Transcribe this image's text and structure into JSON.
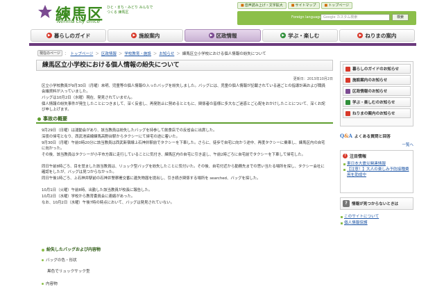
{
  "header": {
    "logo_kanji": "練馬区",
    "logo_roman": "Nerima city office",
    "tagline": "ひと・まち・みどり みんなでつくる 練馬区",
    "top_links": [
      "音声読み上げ・文字拡大",
      "サイトマップ",
      "トップページ"
    ],
    "lang_link": "Foreign language",
    "search_placeholder": "Google カスタム検索",
    "search_button": "検索"
  },
  "nav": [
    {
      "label": "暮らしのガイド",
      "icon": "arrow-circle-icon",
      "color": "#d8382a",
      "active": false
    },
    {
      "label": "施設案内",
      "icon": "arrow-circle-icon",
      "color": "#d8382a",
      "active": false
    },
    {
      "label": "区政情報",
      "icon": "arrow-circle-icon",
      "color": "#7b4a91",
      "active": true
    },
    {
      "label": "学ぶ・楽しむ",
      "icon": "arrow-circle-icon",
      "color": "#2f8f3a",
      "active": false
    },
    {
      "label": "ねりまの案内",
      "icon": "arrow-circle-icon",
      "color": "#d8382a",
      "active": false
    }
  ],
  "breadcrumb": {
    "label": "現在のページ",
    "items": [
      "トップページ",
      "区政情報",
      "学校教育・施設",
      "お知らせ"
    ],
    "current": "練馬区立小学校における個人情報の紛失について"
  },
  "main": {
    "title": "練馬区立小学校における個人情報の紛失について",
    "updated": "更新日：2013年10月2日",
    "intro": [
      "区立小学校教員が9月30日（月曜）未明、児童等の個人情報の入ったバッグを紛失しました。バッグには、児童の個人情報が記載されている過ごとの指導計画および職員会議資料が入っていました。",
      "バッグは10月2日（水曜）現在、発見されていません。",
      "個人情報の紛失事件が発生したことにつきまして、深く反省し、再発防止に努めるとともに、関係者の皆様に多大なご迷惑とご心配をおかけしたことについて、深くお詫び申し上げます。"
    ],
    "section_title": "事故の概要",
    "overview": [
      "9月29日（日曜）は運動会があり、該当教員は紛失したバッグを持参して飲食店での反省会に出席した。",
      "深夜の帰宅となり、西武池袋線練馬高野台駅からタクシーにて帰宅の途に着いた。",
      "9月30日（月曜）午前0時20分に該当教員は西武新宿線上石神井駅前でタクシーを下車した。さらに、徒歩で自宅に向かう途中、再度タクシーに乗車し、練馬区内の自宅に向かった。",
      "その後、該当教員はタクシーが小平市方面に走行していることに気付き、練馬区内の自宅に引き返し、午前2時ごろに自宅前でタクシーを下車して帰宅した。",
      "同日午前8時ごろ、目を覚ました該当教員は、リュック型バッグを紛失したことに気付いた。その後、自宅付近から勤務先までの思い当たる場所を探し、タクシー会社に確認をしたが、バッグは見つからなかった。",
      "同日午後1時ごろ、上石神井駅前の石神井警察署交番に遺失物届を提出し、引き続き関係する場所を searched、バッグを探した。",
      "10月1日（火曜）午前8時、出勤した該当教員が校長に報告した。",
      "10月2日（水曜）学校から教育委員会に連絡があった。",
      "なお、10月2日（水曜）午後7時の時点において、バッグは発見されていない。"
    ],
    "sub_heading": "紛失したバッグおよび内容物",
    "bag_label": "バッグの色・形状",
    "bag_desc": "黒色でリュックサック型",
    "contents_label": "内容物"
  },
  "side": {
    "news": [
      {
        "label": "暮らしのガイドのお知らせ",
        "color": "#d8382a"
      },
      {
        "label": "施設案内のお知らせ",
        "color": "#d8382a"
      },
      {
        "label": "区政情報のお知らせ",
        "color": "#7b4a91"
      },
      {
        "label": "学ぶ・楽しむのお知らせ",
        "color": "#2f8f3a"
      },
      {
        "label": "ねりまの案内のお知らせ",
        "color": "#d8382a"
      }
    ],
    "faq_label": "よくある質問と回答",
    "ichiran": "一覧へ",
    "attention_title": "注目情報",
    "attention_links": [
      "東日本大震災関連情報",
      "【注意！】大人の楽しみ予防接種費用を助成中"
    ],
    "notfound_label": "情報が見つからないときは",
    "site_links": [
      "このサイトについて",
      "個人情報保護"
    ]
  }
}
